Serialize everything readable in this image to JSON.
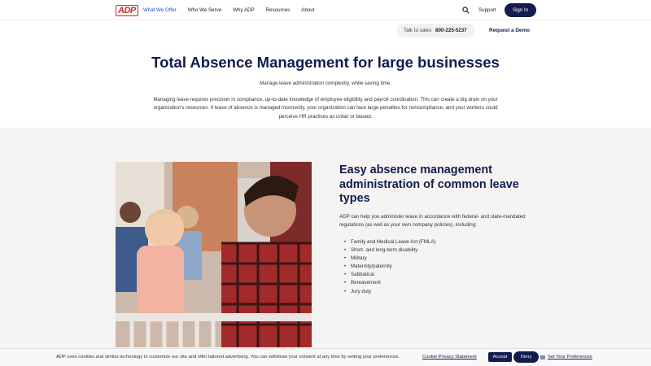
{
  "header": {
    "logo": "ADP",
    "nav": [
      "What We Offer",
      "Who We Serve",
      "Why ADP",
      "Resources",
      "About"
    ],
    "support_label": "Support",
    "signin_label": "Sign In"
  },
  "subbar": {
    "talk_label": "Talk to sales",
    "phone": "800-225-5237",
    "demo_label": "Request a Demo"
  },
  "intro": {
    "title": "Total Absence Management for large businesses",
    "subtitle": "Manage leave administration complexity, while saving time.",
    "paragraph": "Managing leave requires precision in compliance, up-to-date knowledge of employee eligibility and payroll coordination. This can create a big drain on your organization's resources. If leave of absence is managed incorrectly, your organization can face large penalties for noncompliance, and your workers could perceive HR practices as unfair or biased."
  },
  "feature": {
    "title": "Easy absence management administration of common leave types",
    "body": "ADP can help you administer leave in accordance with federal- and state-mandated regulations (as well as your own company policies), including:",
    "items": [
      "Family and Medical Leave Act (FMLA)",
      "Short- and long-term disability",
      "Military",
      "Maternity/paternity",
      "Sabbatical",
      "Bereavement",
      "Jury duty"
    ]
  },
  "cookie": {
    "text": "ADP uses cookies and similar technology to customize our site and offer tailored advertising. You can withdraw your consent at any time by setting your preferences.",
    "privacy_link": "Cookie Privacy Statement",
    "accept_label": "Accept",
    "deny_label": "Deny",
    "prefs_link": "Set Your Preferences"
  },
  "colors": {
    "brand_red": "#d0271d",
    "navy": "#121c4e",
    "active_nav": "#1f4fd1",
    "section_bg": "#f5f4f2"
  }
}
